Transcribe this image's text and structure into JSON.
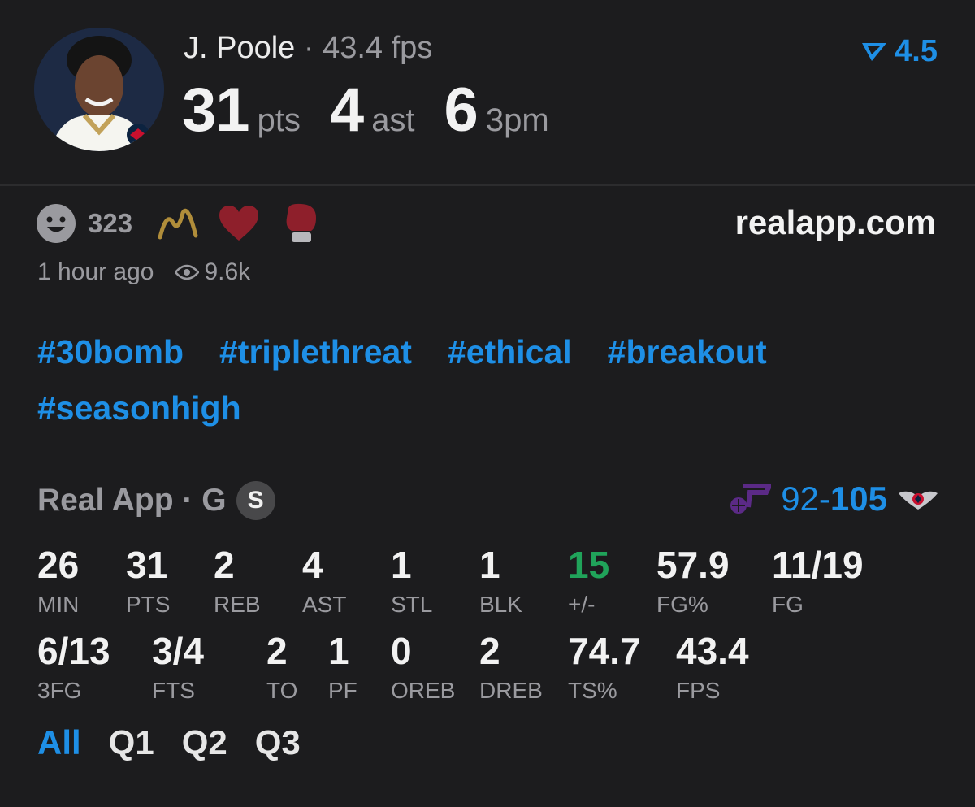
{
  "player": {
    "name": "J. Poole",
    "separator": "·",
    "fps": "43.4 fps"
  },
  "headline": [
    {
      "value": "31",
      "unit": "pts"
    },
    {
      "value": "4",
      "unit": "ast"
    },
    {
      "value": "6",
      "unit": "3pm"
    }
  ],
  "boost": {
    "value": "4.5"
  },
  "reactions": {
    "count": "323"
  },
  "site": "realapp.com",
  "meta": {
    "time": "1 hour ago",
    "views": "9.6k"
  },
  "tags": [
    "#30bomb",
    "#triplethreat",
    "#ethical",
    "#breakout",
    "#seasonhigh"
  ],
  "source": {
    "label": "Real App · G",
    "badge": "S"
  },
  "score": {
    "away": "92",
    "dash": "-",
    "home": "105"
  },
  "stats_row1": [
    {
      "value": "26",
      "label": "MIN"
    },
    {
      "value": "31",
      "label": "PTS"
    },
    {
      "value": "2",
      "label": "REB"
    },
    {
      "value": "4",
      "label": "AST"
    },
    {
      "value": "1",
      "label": "STL"
    },
    {
      "value": "1",
      "label": "BLK"
    },
    {
      "value": "15",
      "label": "+/-"
    },
    {
      "value": "57.9",
      "label": "FG%"
    },
    {
      "value": "11/19",
      "label": "FG"
    }
  ],
  "stats_row2": [
    {
      "value": "6/13",
      "label": "3FG"
    },
    {
      "value": "3/4",
      "label": "FTS"
    },
    {
      "value": "2",
      "label": "TO"
    },
    {
      "value": "1",
      "label": "PF"
    },
    {
      "value": "0",
      "label": "OREB"
    },
    {
      "value": "2",
      "label": "DREB"
    },
    {
      "value": "74.7",
      "label": "TS%"
    },
    {
      "value": "43.4",
      "label": "FPS"
    }
  ],
  "quarter_tabs": [
    "All",
    "Q1",
    "Q2",
    "Q3"
  ],
  "active_tab": "All",
  "colors": {
    "accent": "#1e8fe6",
    "positive": "#20a35a",
    "background": "#1c1c1e"
  }
}
